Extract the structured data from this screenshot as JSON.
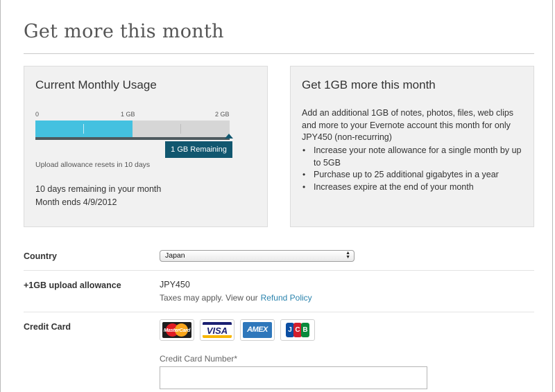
{
  "page": {
    "title": "Get more this month"
  },
  "usage_panel": {
    "heading": "Current Monthly Usage",
    "scale_labels": [
      "0",
      "1 GB",
      "2 GB"
    ],
    "usage_fraction_of_2gb": 0.5,
    "remaining_label": "1 GB Remaining",
    "reset_note": "Upload allowance resets in 10 days",
    "days_remaining": "10 days remaining in your month",
    "month_ends": "Month ends 4/9/2012"
  },
  "offer_panel": {
    "heading": "Get 1GB more this month",
    "description": "Add an additional 1GB of notes, photos, files, web clips and more to your Evernote account this month for only JPY450 (non-recurring)",
    "bullets": [
      "Increase your note allowance for a single month by up to 5GB",
      "Purchase up to 25 additional gigabytes in a year",
      "Increases expire at the end of your month"
    ]
  },
  "form": {
    "country_label": "Country",
    "country_value": "Japan",
    "upload_label": "+1GB upload allowance",
    "price": "JPY450",
    "taxes_text": "Taxes may apply. View our",
    "refund_link": "Refund Policy",
    "credit_card_label": "Credit Card",
    "cards": [
      "MasterCard",
      "VISA",
      "AMEX",
      "JCB"
    ],
    "cc_number_label": "Credit Card Number*",
    "cc_number_value": ""
  },
  "colors": {
    "usage_fill": "#44c1e0",
    "remaining_tag": "#11576f",
    "link": "#2a83ad"
  }
}
